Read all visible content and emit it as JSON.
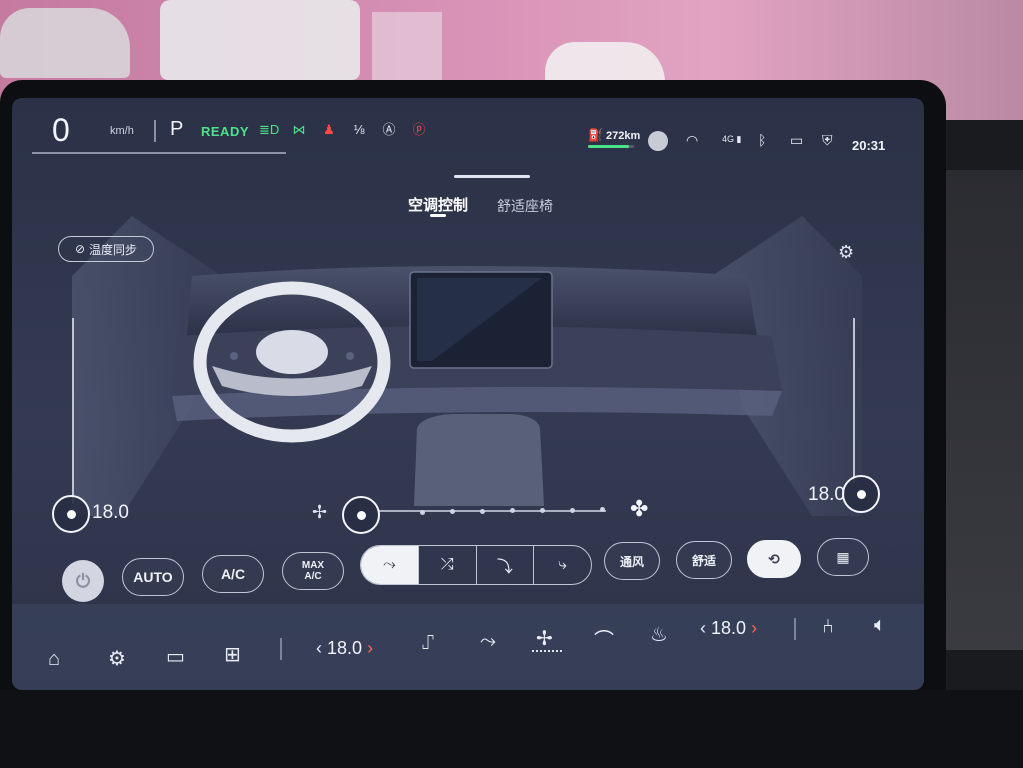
{
  "status": {
    "speed": "0",
    "speed_unit": "km/h",
    "gear": "P",
    "ready": "READY",
    "range": "272km",
    "range_level": 0.9,
    "clock": "20:31",
    "network": "4G"
  },
  "tabs": {
    "ac": "空调控制",
    "seat": "舒适座椅"
  },
  "climate": {
    "sync_label": "温度同步",
    "left_temp": "18.0",
    "right_temp": "18.0",
    "fan_level": 0,
    "fan_steps": 8
  },
  "controls": {
    "auto": "AUTO",
    "ac": "A/C",
    "max_ac_line1": "MAX",
    "max_ac_line2": "A/C",
    "ventilate": "通风",
    "comfort": "舒适"
  },
  "dock": {
    "left_temp": "18.0",
    "right_temp": "18.0"
  },
  "colors": {
    "accent_green": "#4ee28a",
    "warning_red": "#ff4a4a",
    "chevron_red": "#ff6a4d"
  }
}
